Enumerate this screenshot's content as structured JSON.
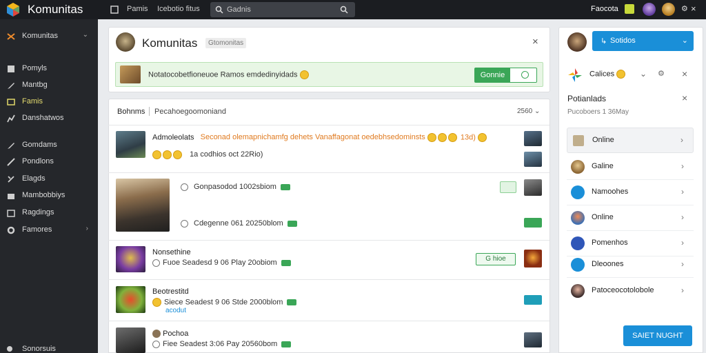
{
  "topbar": {
    "title": "Komunitas",
    "nav": [
      "Pamis",
      "Icebotio fitus"
    ],
    "search_text": "Gadnis",
    "right_label": "Faocota"
  },
  "sidebar": {
    "header": "Komunitas",
    "items": [
      {
        "label": "Pomyls",
        "icon": "bars-icon"
      },
      {
        "label": "Mantbg",
        "icon": "pencil-icon"
      },
      {
        "label": "Famis",
        "icon": "grid-icon",
        "active": true
      },
      {
        "label": "Danshatwos",
        "icon": "chart-icon"
      },
      {
        "label": "Gomdams",
        "icon": "edit-icon"
      },
      {
        "label": "Pondlons",
        "icon": "brush-icon"
      },
      {
        "label": "Elagds",
        "icon": "tools-icon"
      },
      {
        "label": "Mambobbiys",
        "icon": "folder-icon"
      },
      {
        "label": "Ragdings",
        "icon": "calendar-icon"
      },
      {
        "label": "Famores",
        "icon": "gear-icon"
      }
    ],
    "footer": "Sonorsuis"
  },
  "dialog": {
    "title": "Komunitas",
    "badge": "Gtomonitas",
    "notice": "Notatocobetfioneuoe Ramos emdedinyidads",
    "cta": "Gonnie"
  },
  "feed": {
    "tab_active": "Bohnms",
    "tab_other": "Pecahoegoomoniand",
    "sort_label": "2560",
    "posts": [
      {
        "title": "Admoleolats",
        "text": "Seconad olemapnichamfg dehets Vanaffagonat oedebhsedominsts",
        "stats": "13d)",
        "sub": "1a codhios oct 22Rio)"
      },
      {
        "meta_1": "Gonpasodod 1002sbiom",
        "meta_2": "Cdegenne 061 20250blom"
      },
      {
        "title": "Nonsethine",
        "meta": "Fuoe Seadesd 9 06 Play 20obiom",
        "button": "G hioe"
      },
      {
        "title": "Beotrestitd",
        "meta": "Siece Seadest 9 06 Stde 2000blom",
        "link": "acodut"
      },
      {
        "title": "Pochoa",
        "meta": "Fiee Seadest 3:06 Pay 20560bom"
      }
    ]
  },
  "right_panel": {
    "top_button": "Sotidos",
    "header": "Calices",
    "section_title": "Potianlads",
    "section_sub": "Pucoboers 1 36May",
    "items": [
      "Online",
      "Galine",
      "Namoohes",
      "Online",
      "Pomenhos",
      "Dleoones",
      "Patoceocotolobole"
    ],
    "footer_button": "SAIET NUGHT"
  },
  "colors": {
    "accent_blue": "#1a8fd8",
    "green": "#3aa657",
    "orange_text": "#e07a1f",
    "notice_bg": "#e8f6e5"
  }
}
